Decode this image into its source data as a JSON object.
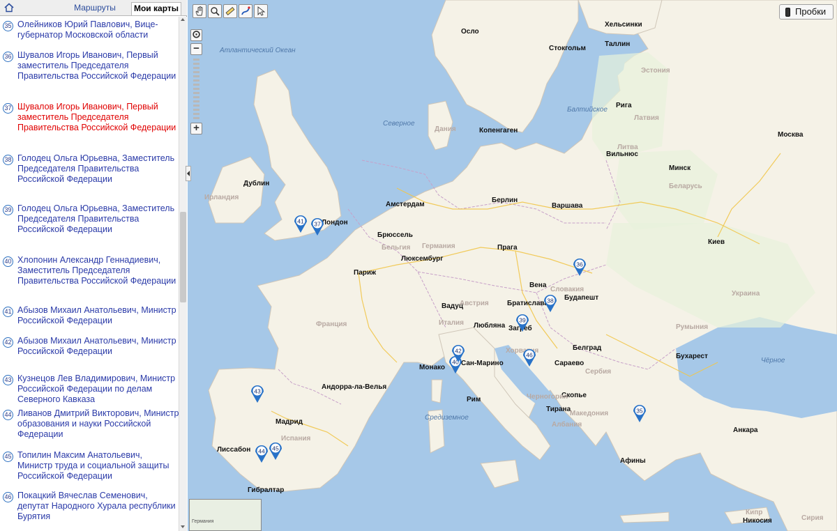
{
  "left_panel": {
    "tabs": [
      {
        "label": "Маршруты"
      },
      {
        "label": "Мои карты"
      }
    ],
    "items": [
      {
        "num": "35",
        "text": "Олейников Юрий Павлович, Вице-губернатор Московской области",
        "active": false
      },
      {
        "num": "36",
        "text": "Шувалов Игорь Иванович, Первый заместитель Председателя Правительства Российской Федерации",
        "active": false
      },
      {
        "num": "37",
        "text": "Шувалов Игорь Иванович, Первый заместитель Председателя Правительства Российской Федерации",
        "active": true
      },
      {
        "num": "38",
        "text": "Голодец Ольга Юрьевна, Заместитель Председателя Правительства Российской Федерации",
        "active": false
      },
      {
        "num": "39",
        "text": "Голодец Ольга Юрьевна, Заместитель Председателя Правительства Российской Федерации",
        "active": false
      },
      {
        "num": "40",
        "text": "Хлопонин Александр Геннадиевич, Заместитель Председателя Правительства Российской Федерации",
        "active": false
      },
      {
        "num": "41",
        "text": "Абызов Михаил Анатольевич, Министр Российской Федерации",
        "active": false
      },
      {
        "num": "42",
        "text": "Абызов Михаил Анатольевич, Министр Российской Федерации",
        "active": false
      },
      {
        "num": "43",
        "text": "Кузнецов Лев Владимирович, Министр Российской Федерации по делам Северного Кавказа",
        "active": false
      },
      {
        "num": "44",
        "text": "Ливанов Дмитрий Викторович, Министр образования и науки Российской Федерации",
        "active": false
      },
      {
        "num": "45",
        "text": "Топилин Максим Анатольевич, Министр труда и социальной защиты Российской Федерации",
        "active": false
      },
      {
        "num": "46",
        "text": "Покацкий Вячеслав Семенович, депутат Народного Хурала республики Бурятия",
        "active": false
      }
    ]
  },
  "toolbar": {
    "tools": [
      {
        "icon": "hand-icon"
      },
      {
        "icon": "magnifier-icon"
      },
      {
        "icon": "ruler-icon"
      },
      {
        "icon": "route-icon"
      },
      {
        "icon": "pointer-icon"
      }
    ],
    "zoom_in": "+",
    "zoom_out": "−",
    "traffic_label": "Пробки"
  },
  "map": {
    "colors": {
      "sea": "#a6c8e8",
      "land": "#f5f2e7",
      "marker": "#2872c8",
      "city": "#111111",
      "country": "#b8a9a2"
    },
    "places": [
      {
        "name": "Атлантический Океан",
        "type": "sea"
      },
      {
        "name": "Осло",
        "type": "city"
      },
      {
        "name": "Стокгольм",
        "type": "city"
      },
      {
        "name": "Хельсинки",
        "type": "city"
      },
      {
        "name": "Таллин",
        "type": "city"
      },
      {
        "name": "Рига",
        "type": "city"
      },
      {
        "name": "Вильнюс",
        "type": "city"
      },
      {
        "name": "Копенгаген",
        "type": "city"
      },
      {
        "name": "Дублин",
        "type": "city"
      },
      {
        "name": "Лондон",
        "type": "city"
      },
      {
        "name": "Амстердам",
        "type": "city"
      },
      {
        "name": "Брюссель",
        "type": "city"
      },
      {
        "name": "Люксембург",
        "type": "city"
      },
      {
        "name": "Париж",
        "type": "city"
      },
      {
        "name": "Берлин",
        "type": "city"
      },
      {
        "name": "Варшава",
        "type": "city"
      },
      {
        "name": "Прага",
        "type": "city"
      },
      {
        "name": "Вена",
        "type": "city"
      },
      {
        "name": "Братислава",
        "type": "city"
      },
      {
        "name": "Будапешт",
        "type": "city"
      },
      {
        "name": "Вадуц",
        "type": "city"
      },
      {
        "name": "Любляна",
        "type": "city"
      },
      {
        "name": "Загреб",
        "type": "city"
      },
      {
        "name": "Белград",
        "type": "city"
      },
      {
        "name": "Бухарест",
        "type": "city"
      },
      {
        "name": "Сараево",
        "type": "city"
      },
      {
        "name": "Скопье",
        "type": "city"
      },
      {
        "name": "Тирана",
        "type": "city"
      },
      {
        "name": "Афины",
        "type": "city"
      },
      {
        "name": "Анкара",
        "type": "city"
      },
      {
        "name": "Никосия",
        "type": "city"
      },
      {
        "name": "Москва",
        "type": "city"
      },
      {
        "name": "Киев",
        "type": "city"
      },
      {
        "name": "Минск",
        "type": "city"
      },
      {
        "name": "Мадрид",
        "type": "city"
      },
      {
        "name": "Лиссабон",
        "type": "city"
      },
      {
        "name": "Андорра-ла-Велья",
        "type": "city"
      },
      {
        "name": "Монако",
        "type": "city"
      },
      {
        "name": "Сан-Марино",
        "type": "city"
      },
      {
        "name": "Рим",
        "type": "city"
      },
      {
        "name": "Гибралтар",
        "type": "city"
      },
      {
        "name": "Дания",
        "type": "country"
      },
      {
        "name": "Ирландия",
        "type": "country"
      },
      {
        "name": "Германия",
        "type": "country"
      },
      {
        "name": "Бельгия",
        "type": "country"
      },
      {
        "name": "Франция",
        "type": "country"
      },
      {
        "name": "Испания",
        "type": "country"
      },
      {
        "name": "Италия",
        "type": "country"
      },
      {
        "name": "Австрия",
        "type": "country"
      },
      {
        "name": "Словакия",
        "type": "country"
      },
      {
        "name": "Хорватия",
        "type": "country"
      },
      {
        "name": "Сербия",
        "type": "country"
      },
      {
        "name": "Черногория",
        "type": "country"
      },
      {
        "name": "Албания",
        "type": "country"
      },
      {
        "name": "Македония",
        "type": "country"
      },
      {
        "name": "Литва",
        "type": "country"
      },
      {
        "name": "Латвия",
        "type": "country"
      },
      {
        "name": "Эстония",
        "type": "country"
      },
      {
        "name": "Беларусь",
        "type": "country"
      },
      {
        "name": "Украина",
        "type": "country"
      },
      {
        "name": "Румыния",
        "type": "country"
      },
      {
        "name": "Кипр",
        "type": "country"
      },
      {
        "name": "Сирия",
        "type": "country"
      },
      {
        "name": "Средиземное",
        "type": "sea"
      },
      {
        "name": "Балтийское",
        "type": "sea"
      },
      {
        "name": "Северное",
        "type": "sea"
      },
      {
        "name": "Чёрное",
        "type": "sea"
      }
    ],
    "markers": [
      "35",
      "36",
      "37",
      "38",
      "39",
      "40",
      "41",
      "42",
      "43",
      "44",
      "45",
      "46"
    ],
    "minimap_label": "Германия"
  }
}
